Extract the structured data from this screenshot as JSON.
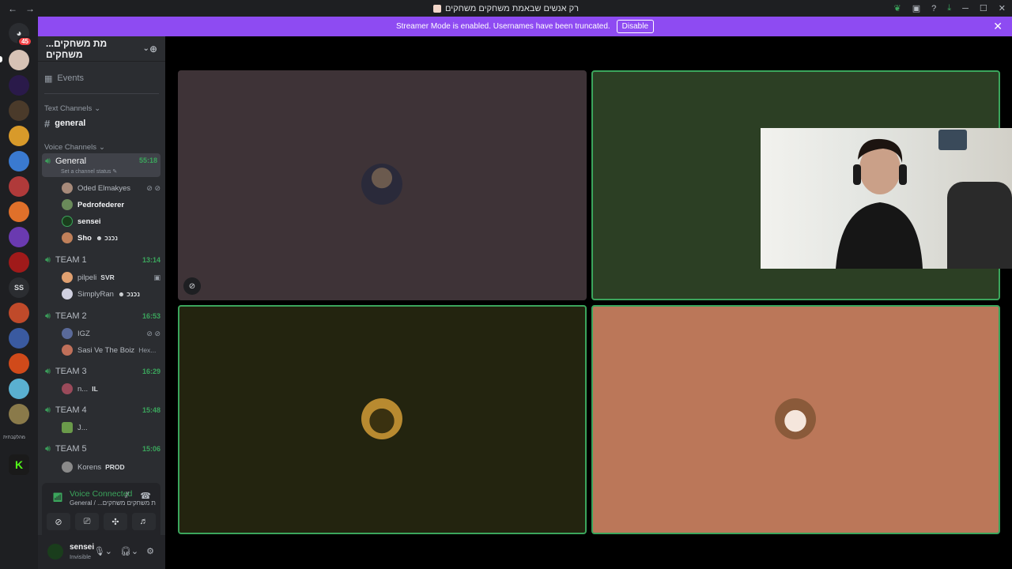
{
  "window": {
    "title": "רק אנשים שבאמת משחקים משחקים",
    "nav_back": "←",
    "nav_forward": "→"
  },
  "banner": {
    "text": "Streamer Mode is enabled. Usernames have been truncated.",
    "button": "Disable",
    "close": "✕"
  },
  "rail": {
    "home_badge": "45",
    "text_server": "SS",
    "small_label": "מהלקבתית"
  },
  "guild": {
    "name": "...מת משחקים משחקים",
    "events": "Events",
    "text_category": "Text Channels",
    "text_channels": [
      "general"
    ],
    "voice_category": "Voice Channels"
  },
  "voice_channels": [
    {
      "name": "General",
      "time": "55:18",
      "status": "Set a channel status",
      "members": [
        {
          "name": "Oded Elmakyes",
          "tag": "",
          "icons": "⊘ ⊘"
        },
        {
          "name": "Pedrofederer",
          "tag": "",
          "icons": ""
        },
        {
          "name": "sensei",
          "tag": "",
          "icons": ""
        },
        {
          "name": "Sho",
          "tag": "☻ נכנכ",
          "icons": ""
        }
      ]
    },
    {
      "name": "TEAM 1",
      "time": "13:14",
      "members": [
        {
          "name": "pilpeli",
          "tag": "SVR",
          "icons": "▣"
        },
        {
          "name": "SimplyRan",
          "tag": "☻ נכנכ",
          "icons": ""
        }
      ]
    },
    {
      "name": "TEAM 2",
      "time": "16:53",
      "members": [
        {
          "name": "IGZ",
          "tag": "",
          "icons": "⊘ ⊘"
        },
        {
          "name": "Sasi Ve The Boiz",
          "tag": "Hex...",
          "icons": ""
        }
      ]
    },
    {
      "name": "TEAM 3",
      "time": "16:29",
      "members": [
        {
          "name": "n...",
          "tag": "IL",
          "icons": ""
        }
      ]
    },
    {
      "name": "TEAM 4",
      "time": "15:48",
      "members": [
        {
          "name": "J...",
          "tag": "",
          "icons": ""
        }
      ]
    },
    {
      "name": "TEAM 5",
      "time": "15:06",
      "members": [
        {
          "name": "Korens",
          "tag": "PROD",
          "icons": ""
        }
      ]
    }
  ],
  "voice_panel": {
    "title": "Voice Connected",
    "subtitle": "General / ...ת משחקים משחקים"
  },
  "user": {
    "name": "sensei",
    "status": "Invisible"
  },
  "colors": {
    "accent_green": "#3ba55c",
    "banner_purple": "#8e4bf2",
    "tile1": "#3e3337",
    "tile2": "#2c3f24",
    "tile3": "#23240f",
    "tile4": "#bb7759"
  }
}
